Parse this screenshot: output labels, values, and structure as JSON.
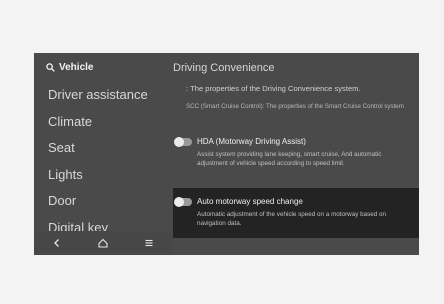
{
  "sidebar": {
    "search_label": "Vehicle",
    "items": [
      {
        "label": "Driver assistance"
      },
      {
        "label": "Climate"
      },
      {
        "label": "Seat"
      },
      {
        "label": "Lights"
      },
      {
        "label": "Door"
      },
      {
        "label": "Digital key"
      }
    ]
  },
  "bottom_bar": {
    "icons": [
      "back-icon",
      "home-icon",
      "menu-icon"
    ]
  },
  "content": {
    "title": "Driving Convenience",
    "description": ": The properties of the Driving Convenience system.",
    "scc_note": "SCC (Smart Cruise Control): The properties of the Smart Cruise Control system",
    "options": [
      {
        "title": "HDA (Motorway Driving Assist)",
        "description": "Assist system providing lane keeping, smart cruise, And automatic adjustment of vehicle speed according to speed limit.",
        "enabled": false
      },
      {
        "title": "Auto motorway speed change",
        "description": "Automatic adjustment of the vehicle speed on a motorway based on navigation data.",
        "enabled": false,
        "highlighted": true
      }
    ]
  },
  "colors": {
    "screen_bg": "#4a4a4a",
    "highlight_bg": "#232323",
    "page_bg": "#f3f3f3"
  }
}
